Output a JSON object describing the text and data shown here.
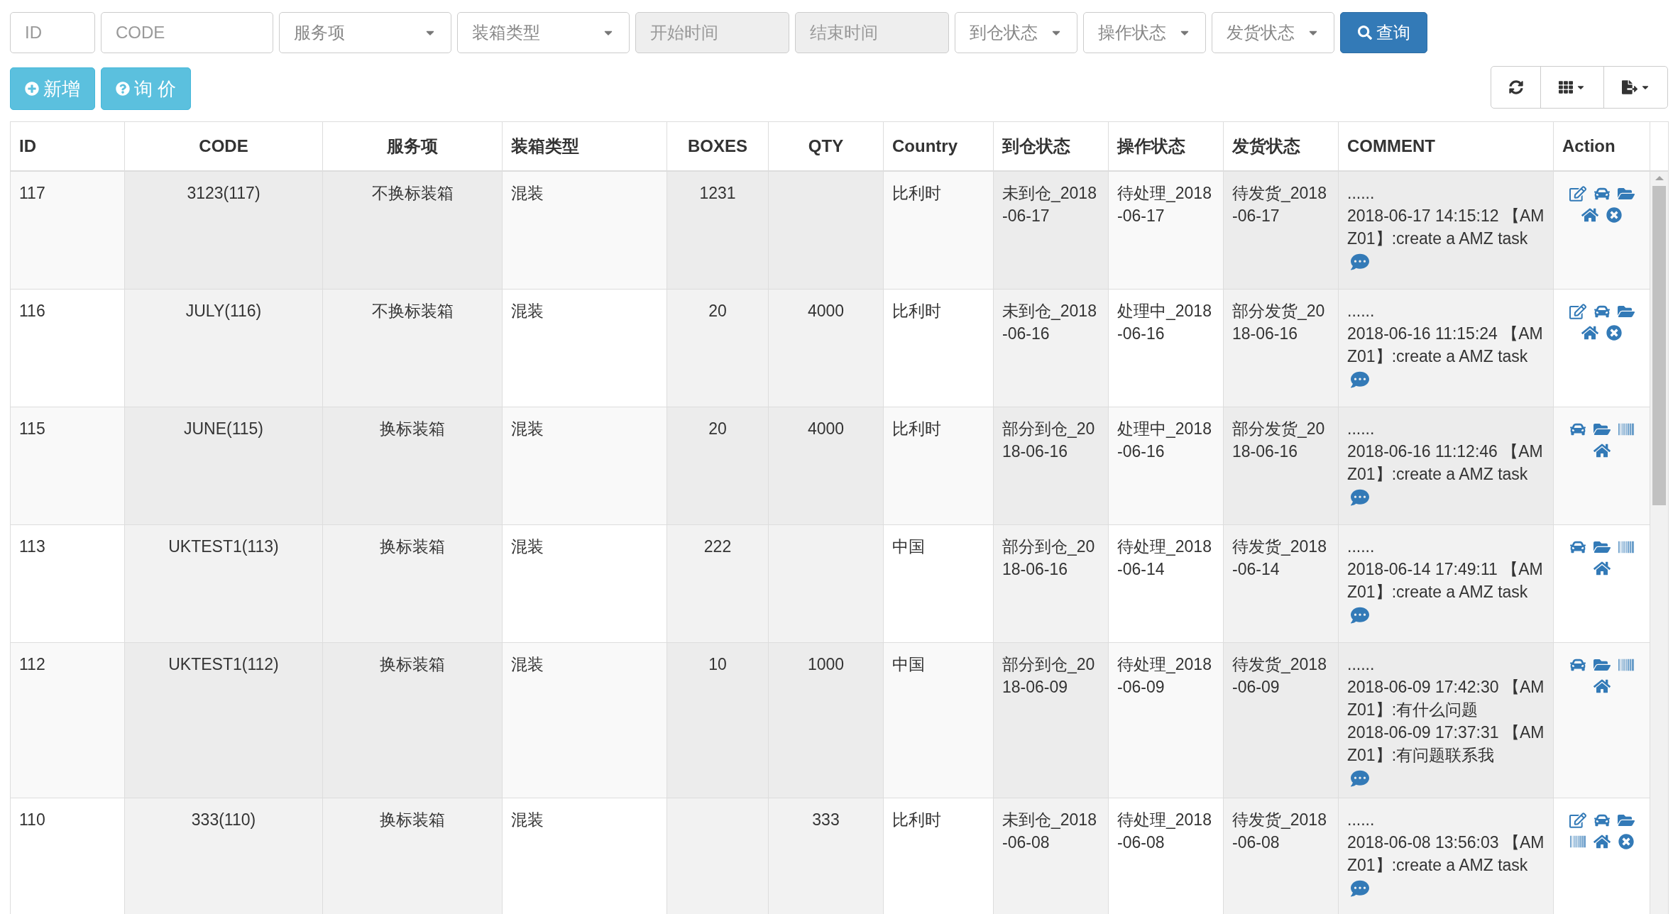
{
  "filters": [
    {
      "kind": "input",
      "placeholder": "ID"
    },
    {
      "kind": "input",
      "placeholder": "CODE"
    },
    {
      "kind": "select",
      "placeholder": "服务项"
    },
    {
      "kind": "select",
      "placeholder": "装箱类型"
    },
    {
      "kind": "date",
      "placeholder": "开始时间"
    },
    {
      "kind": "date",
      "placeholder": "结束时间"
    },
    {
      "kind": "select",
      "placeholder": "到仓状态"
    },
    {
      "kind": "select",
      "placeholder": "操作状态"
    },
    {
      "kind": "select",
      "placeholder": "发货状态"
    }
  ],
  "search_button": "查询",
  "buttons": [
    {
      "kind": "add",
      "label": "新增"
    },
    {
      "kind": "inquiry",
      "label": "询 价"
    }
  ],
  "table": {
    "columns": [
      "ID",
      "CODE",
      "服务项",
      "装箱类型",
      "BOXES",
      "QTY",
      "Country",
      "到仓状态",
      "操作状态",
      "发货状态",
      "COMMENT",
      "Action"
    ],
    "rows": [
      {
        "id": "117",
        "code": "3123(117)",
        "service": "不换标装箱",
        "packing": "混装",
        "boxes": "1231",
        "country": "比利时",
        "arrival": "未到仓_2018-06-17",
        "operation": "待处理_2018-06-17",
        "shipping": "待发货_2018-06-17",
        "comment": [
          "......",
          "2018-06-17 14:15:12 【AMZ01】:create a AMZ task"
        ],
        "actions": {
          "edit": true,
          "car": true,
          "folder": true,
          "barcode": false,
          "home": true,
          "close": true
        }
      },
      {
        "id": "116",
        "code": "JULY(116)",
        "service": "不换标装箱",
        "packing": "混装",
        "boxes": "20",
        "qty": "4000",
        "country": "比利时",
        "arrival": "未到仓_2018-06-16",
        "operation": "处理中_2018-06-16",
        "shipping": "部分发货_2018-06-16",
        "comment": [
          "......",
          "2018-06-16 11:15:24 【AMZ01】:create a AMZ task"
        ],
        "actions": {
          "edit": true,
          "car": true,
          "folder": true,
          "barcode": false,
          "home": true,
          "close": true
        }
      },
      {
        "id": "115",
        "code": "JUNE(115)",
        "service": "换标装箱",
        "packing": "混装",
        "boxes": "20",
        "qty": "4000",
        "country": "比利时",
        "arrival": "部分到仓_2018-06-16",
        "operation": "处理中_2018-06-16",
        "shipping": "部分发货_2018-06-16",
        "comment": [
          "......",
          "2018-06-16 11:12:46 【AMZ01】:create a AMZ task"
        ],
        "actions": {
          "edit": false,
          "car": true,
          "folder": true,
          "barcode": true,
          "home": true,
          "close": false
        }
      },
      {
        "id": "113",
        "code": "UKTEST1(113)",
        "service": "换标装箱",
        "packing": "混装",
        "boxes": "222",
        "country": "中国",
        "arrival": "部分到仓_2018-06-16",
        "operation": "待处理_2018-06-14",
        "shipping": "待发货_2018-06-14",
        "comment": [
          "......",
          "2018-06-14 17:49:11 【AMZ01】:create a AMZ task"
        ],
        "actions": {
          "edit": false,
          "car": true,
          "folder": true,
          "barcode": true,
          "home": true,
          "close": false
        }
      },
      {
        "id": "112",
        "code": "UKTEST1(112)",
        "service": "换标装箱",
        "packing": "混装",
        "boxes": "10",
        "qty": "1000",
        "country": "中国",
        "arrival": "部分到仓_2018-06-09",
        "operation": "待处理_2018-06-09",
        "shipping": "待发货_2018-06-09",
        "comment": [
          "......",
          "2018-06-09 17:42:30 【AMZ01】:有什么问题",
          "2018-06-09 17:37:31 【AMZ01】:有问题联系我"
        ],
        "actions": {
          "edit": false,
          "car": true,
          "folder": true,
          "barcode": true,
          "home": true,
          "close": false
        }
      },
      {
        "id": "110",
        "code": "333(110)",
        "service": "换标装箱",
        "packing": "混装",
        "qty": "333",
        "country": "比利时",
        "arrival": "未到仓_2018-06-08",
        "operation": "待处理_2018-06-08",
        "shipping": "待发货_2018-06-08",
        "comment": [
          "......",
          "2018-06-08 13:56:03 【AMZ01】:create a AMZ task"
        ],
        "actions": {
          "edit": true,
          "car": true,
          "folder": true,
          "barcode": true,
          "home": true,
          "close": true
        }
      }
    ]
  }
}
